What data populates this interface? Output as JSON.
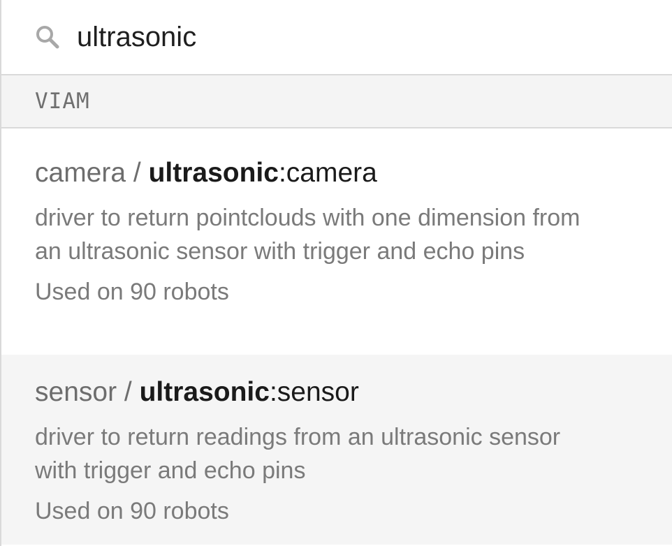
{
  "search": {
    "icon": "search-icon",
    "value": "ultrasonic"
  },
  "group": {
    "label": "VIAM"
  },
  "results": [
    {
      "category": "camera",
      "separator": " / ",
      "match": "ultrasonic",
      "suffix": ":camera",
      "description": "driver to return pointclouds with one dimension from an ultrasonic sensor with trigger and echo pins",
      "usage": "Used on 90 robots"
    },
    {
      "category": "sensor",
      "separator": " / ",
      "match": "ultrasonic",
      "suffix": ":sensor",
      "description": "driver to return readings from an ultrasonic sensor with trigger and echo pins",
      "usage": "Used on 90 robots"
    }
  ],
  "colors": {
    "hover_background": "#f5f5f5",
    "group_background": "#f4f4f4",
    "muted_text": "#7a7a7a",
    "strong_text": "#1a1a1a"
  }
}
